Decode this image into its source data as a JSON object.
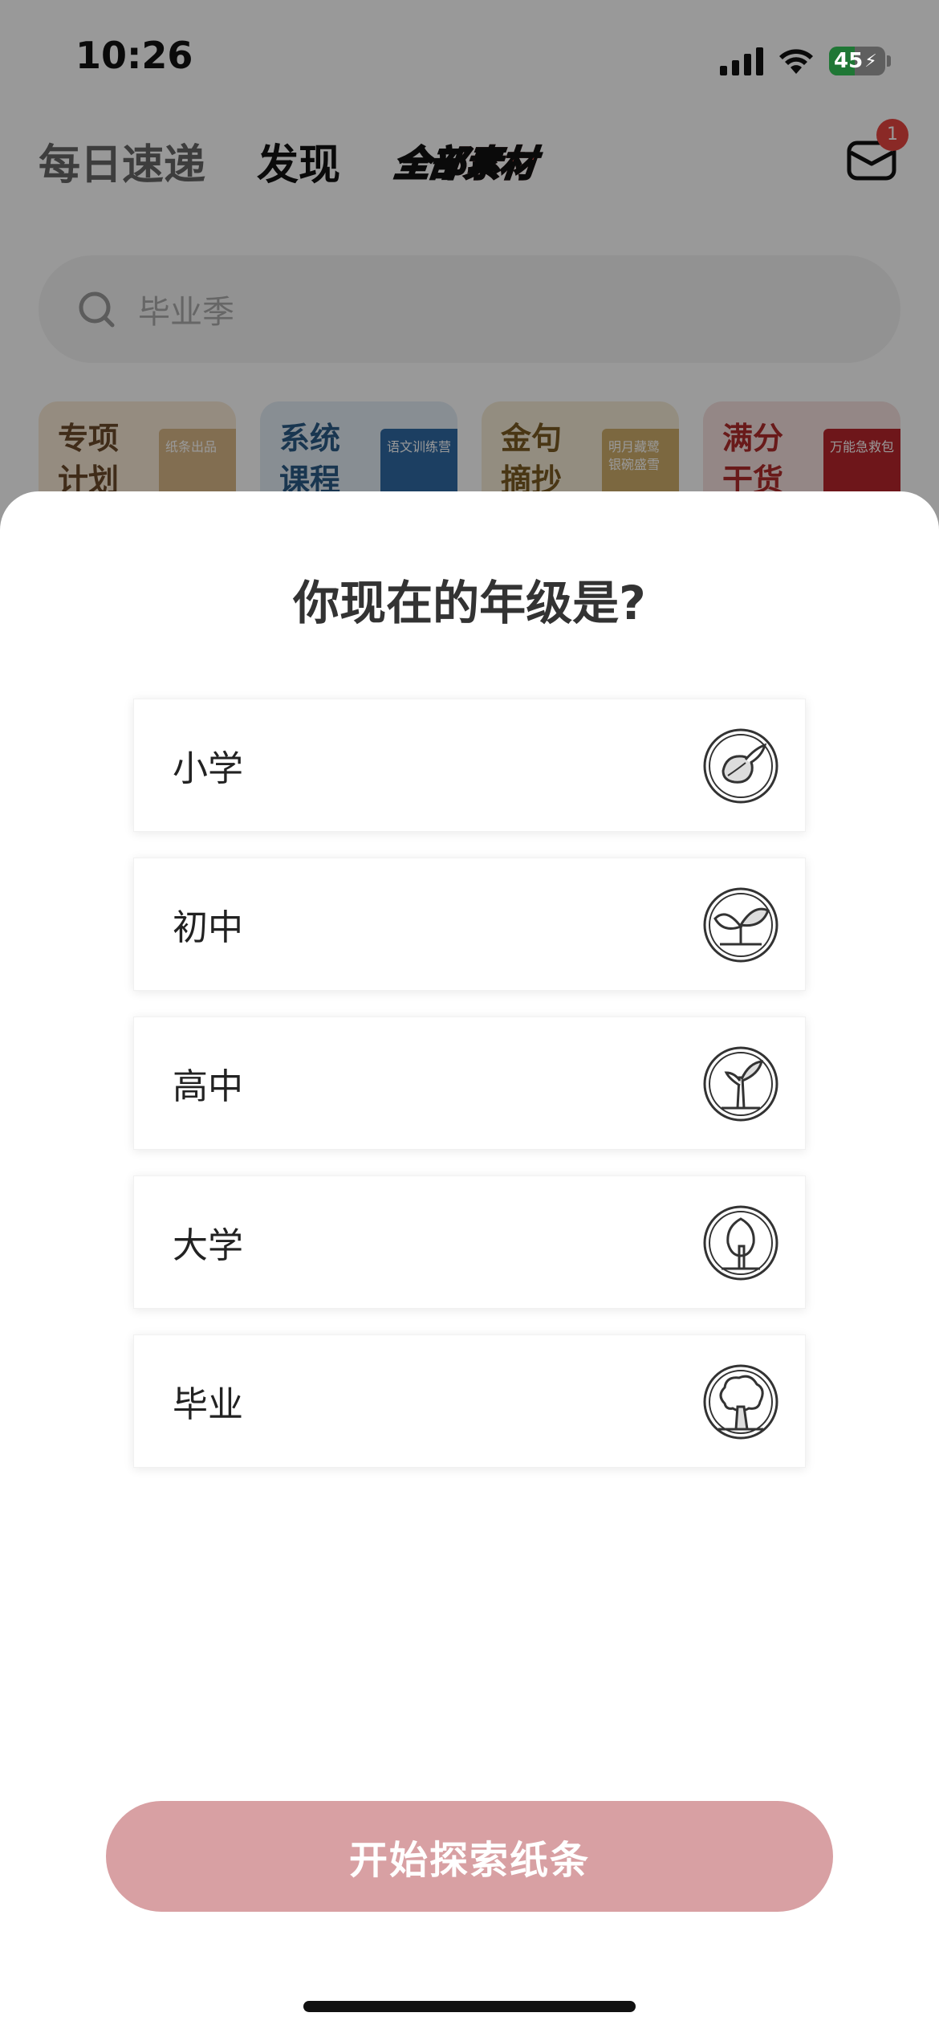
{
  "status_bar": {
    "time": "10:26",
    "battery": "45",
    "battery_level": 0.45
  },
  "header": {
    "tabs": [
      {
        "label": "每日速递",
        "active": false
      },
      {
        "label": "发现",
        "active": true
      }
    ],
    "badge_tab": "全部素材",
    "mail_badge_count": "1"
  },
  "search": {
    "placeholder": "毕业季"
  },
  "feature_cards": [
    {
      "title": "专项计划",
      "book_text": "纸条出品",
      "bg": "#f8ead6",
      "title_color": "#6b4a2a",
      "book_color": "#d9b887"
    },
    {
      "title": "系统课程",
      "book_text": "语文训练营",
      "bg": "#e3edf6",
      "title_color": "#2b5b86",
      "book_color": "#2f6aa3"
    },
    {
      "title": "金句摘抄",
      "book_text": "明月藏鹭 银碗盛雪",
      "bg": "#f6ecd6",
      "title_color": "#7a5b22",
      "book_color": "#cfae6b"
    },
    {
      "title": "满分干货",
      "book_text": "万能急救包",
      "bg": "#f7e2e0",
      "title_color": "#b02c2c",
      "book_color": "#b8262c"
    }
  ],
  "modal": {
    "title": "你现在的年级是?",
    "options": [
      {
        "label": "小学",
        "icon": "seed-icon"
      },
      {
        "label": "初中",
        "icon": "sprout-icon"
      },
      {
        "label": "高中",
        "icon": "sapling-icon"
      },
      {
        "label": "大学",
        "icon": "young-tree-icon"
      },
      {
        "label": "毕业",
        "icon": "big-tree-icon"
      }
    ],
    "start_button": "开始探索纸条"
  },
  "colors": {
    "accent": "#d8a0a3",
    "badge": "#e64540"
  }
}
